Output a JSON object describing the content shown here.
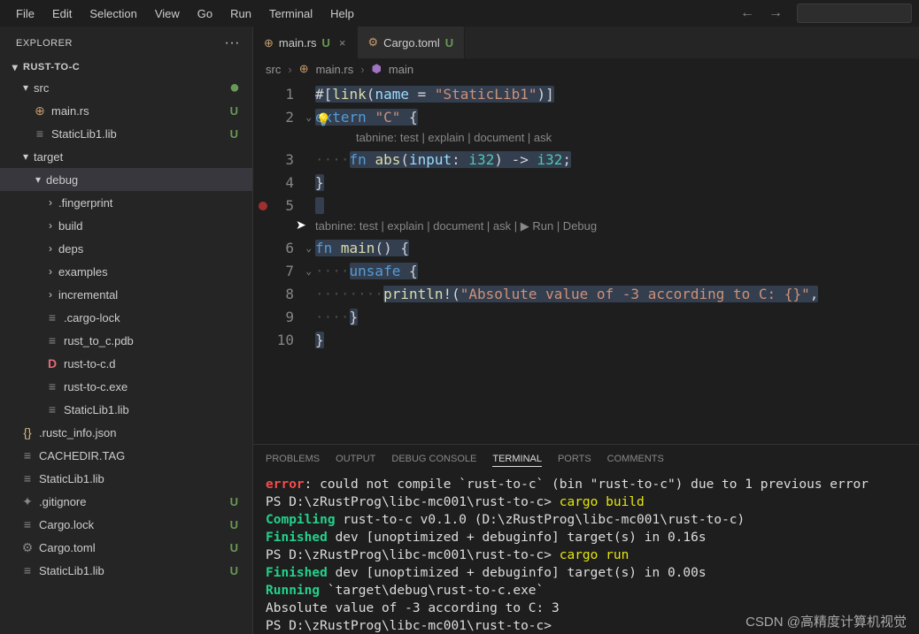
{
  "menu": [
    "File",
    "Edit",
    "Selection",
    "View",
    "Go",
    "Run",
    "Terminal",
    "Help"
  ],
  "explorer": {
    "title": "EXPLORER",
    "dots": "···"
  },
  "project": {
    "name": "RUST-TO-C"
  },
  "tree": [
    {
      "d": 1,
      "ch": "▾",
      "icon": "rust",
      "label": "src",
      "status": "●",
      "cls": "green-text"
    },
    {
      "d": 2,
      "icon": "rust",
      "ichar": "⊕",
      "label": "main.rs",
      "status": "U"
    },
    {
      "d": 2,
      "icon": "lib",
      "ichar": "≡",
      "label": "StaticLib1.lib",
      "status": "U"
    },
    {
      "d": 1,
      "ch": "▾",
      "icon": "",
      "label": "target"
    },
    {
      "d": 2,
      "ch": "▾",
      "icon": "",
      "label": "debug",
      "selected": true
    },
    {
      "d": 3,
      "ch": "›",
      "icon": "",
      "label": ".fingerprint"
    },
    {
      "d": 3,
      "ch": "›",
      "icon": "",
      "label": "build"
    },
    {
      "d": 3,
      "ch": "›",
      "icon": "",
      "label": "deps"
    },
    {
      "d": 3,
      "ch": "›",
      "icon": "",
      "label": "examples"
    },
    {
      "d": 3,
      "ch": "›",
      "icon": "",
      "label": "incremental"
    },
    {
      "d": 3,
      "icon": "lib",
      "ichar": "≡",
      "label": ".cargo-lock"
    },
    {
      "d": 3,
      "icon": "lib",
      "ichar": "≡",
      "label": "rust_to_c.pdb"
    },
    {
      "d": 3,
      "icon": "d",
      "ichar": "D",
      "label": "rust-to-c.d"
    },
    {
      "d": 3,
      "icon": "lib",
      "ichar": "≡",
      "label": "rust-to-c.exe"
    },
    {
      "d": 3,
      "icon": "lib",
      "ichar": "≡",
      "label": "StaticLib1.lib"
    },
    {
      "d": 1,
      "icon": "json",
      "ichar": "{}",
      "label": ".rustc_info.json"
    },
    {
      "d": 1,
      "icon": "lib",
      "ichar": "≡",
      "label": "CACHEDIR.TAG"
    },
    {
      "d": 1,
      "icon": "lib",
      "ichar": "≡",
      "label": "StaticLib1.lib"
    },
    {
      "d": 1,
      "icon": "git",
      "ichar": "✦",
      "label": ".gitignore",
      "status": "U",
      "cls": "green-text"
    },
    {
      "d": 1,
      "icon": "lib",
      "ichar": "≡",
      "label": "Cargo.lock",
      "status": "U",
      "cls": "olive-text"
    },
    {
      "d": 1,
      "icon": "gear",
      "ichar": "⚙",
      "label": "Cargo.toml",
      "status": "U",
      "cls": "olive-text"
    },
    {
      "d": 1,
      "icon": "lib",
      "ichar": "≡",
      "label": "StaticLib1.lib",
      "status": "U",
      "cls": "green-text"
    }
  ],
  "tabs": [
    {
      "icon": "⊕",
      "label": "main.rs",
      "status": "U",
      "close": "×",
      "active": true
    },
    {
      "icon": "⚙",
      "label": "Cargo.toml",
      "status": "U"
    }
  ],
  "breadcrumb": {
    "a": "src",
    "b": "main.rs",
    "c": "main"
  },
  "codelens1": "tabnine: test | explain | document | ask",
  "codelens2": "tabnine: test | explain | document | ask | ▶ Run | Debug",
  "code": {
    "l1a": "#[",
    "l1b": "link",
    "l1c": "(",
    "l1d": "name",
    "l1e": " = ",
    "l1f": "\"StaticLib1\"",
    "l1g": ")]",
    "l2a": "extern",
    "l2b": " ",
    "l2c": "\"C\"",
    "l2d": " {",
    "l3a": "····",
    "l3b": "fn",
    "l3c": " ",
    "l3d": "abs",
    "l3e": "(",
    "l3f": "input",
    "l3g": ": ",
    "l3h": "i32",
    "l3i": ") -> ",
    "l3j": "i32",
    "l3k": ";",
    "l4a": "}",
    "l6a": "fn",
    "l6b": " ",
    "l6c": "main",
    "l6d": "() {",
    "l7a": "····",
    "l7b": "unsafe",
    "l7c": " {",
    "l8a": "········",
    "l8b": "println!",
    "l8c": "(",
    "l8d": "\"Absolute value of -3 according to C: {}\"",
    "l8e": ",",
    "l9a": "····",
    "l9b": "}",
    "l10a": "}"
  },
  "panel_tabs": [
    "PROBLEMS",
    "OUTPUT",
    "DEBUG CONSOLE",
    "TERMINAL",
    "PORTS",
    "COMMENTS"
  ],
  "panel_active": 3,
  "terminal_lines": [
    {
      "segs": [
        {
          "c": "term-red",
          "t": "error"
        },
        {
          "c": "term-white",
          "t": ": could not compile `rust-to-c` (bin \"rust-to-c\") due to 1 previous error"
        }
      ]
    },
    {
      "segs": [
        {
          "c": "term-white",
          "t": "PS D:\\zRustProg\\libc-mc001\\rust-to-c> "
        },
        {
          "c": "term-yellow",
          "t": "cargo build"
        }
      ]
    },
    {
      "segs": [
        {
          "c": "term-white",
          "t": "   "
        },
        {
          "c": "term-green",
          "t": "Compiling"
        },
        {
          "c": "term-white",
          "t": " rust-to-c v0.1.0 (D:\\zRustProg\\libc-mc001\\rust-to-c)"
        }
      ]
    },
    {
      "segs": [
        {
          "c": "term-white",
          "t": "    "
        },
        {
          "c": "term-green",
          "t": "Finished"
        },
        {
          "c": "term-white",
          "t": " dev [unoptimized + debuginfo] target(s) in 0.16s"
        }
      ]
    },
    {
      "segs": [
        {
          "c": "term-white",
          "t": "PS D:\\zRustProg\\libc-mc001\\rust-to-c> "
        },
        {
          "c": "term-yellow",
          "t": "cargo run"
        }
      ]
    },
    {
      "segs": [
        {
          "c": "term-white",
          "t": "    "
        },
        {
          "c": "term-green",
          "t": "Finished"
        },
        {
          "c": "term-white",
          "t": " dev [unoptimized + debuginfo] target(s) in 0.00s"
        }
      ]
    },
    {
      "segs": [
        {
          "c": "term-white",
          "t": "     "
        },
        {
          "c": "term-green",
          "t": "Running"
        },
        {
          "c": "term-white",
          "t": " `target\\debug\\rust-to-c.exe`"
        }
      ]
    },
    {
      "segs": [
        {
          "c": "term-white",
          "t": "Absolute value of -3 according to C: 3"
        }
      ]
    },
    {
      "segs": [
        {
          "c": "term-white",
          "t": "PS D:\\zRustProg\\libc-mc001\\rust-to-c>"
        }
      ]
    }
  ],
  "watermark": "CSDN @高精度计算机视觉"
}
